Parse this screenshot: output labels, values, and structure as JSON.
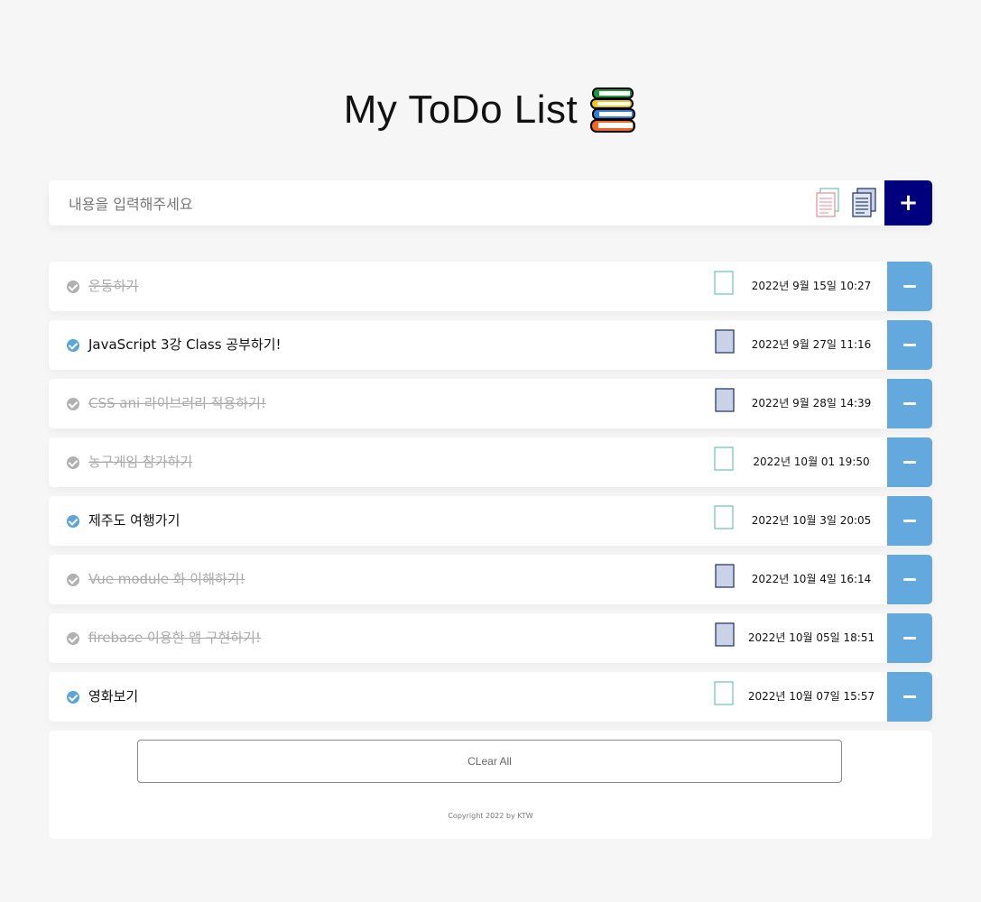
{
  "header": {
    "title": "My ToDo List",
    "icon": "books-icon"
  },
  "input": {
    "placeholder": "내용을 입력해주세요",
    "value": "",
    "add_label": "+",
    "icons": [
      "document-outline-icon",
      "document-blue-icon"
    ]
  },
  "todos": [
    {
      "text": "운동하기",
      "date": "2022년  9월 15일  10:27",
      "completed": true,
      "doc_icon": "document-outline-icon"
    },
    {
      "text": "JavaScript 3강 Class 공부하기!",
      "date": "2022년  9월 27일  11:16",
      "completed": false,
      "doc_icon": "document-blue-icon"
    },
    {
      "text": "CSS ani 라이브러리 적용하기!",
      "date": "2022년  9월 28일  14:39",
      "completed": true,
      "doc_icon": "document-blue-icon"
    },
    {
      "text": "농구게임 참가하기",
      "date": "2022년  10월 01  19:50",
      "completed": true,
      "doc_icon": "document-outline-icon"
    },
    {
      "text": "제주도 여행가기",
      "date": "2022년  10월 3일  20:05",
      "completed": false,
      "doc_icon": "document-outline-icon"
    },
    {
      "text": "Vue module 화 이해하기!",
      "date": "2022년  10월 4일  16:14",
      "completed": true,
      "doc_icon": "document-blue-icon"
    },
    {
      "text": "firebase 이용한 앱 구현하기!",
      "date": "2022년  10월 05일  18:51",
      "completed": true,
      "doc_icon": "document-blue-icon"
    },
    {
      "text": "영화보기",
      "date": "2022년  10월 07일  15:57",
      "completed": false,
      "doc_icon": "document-outline-icon"
    }
  ],
  "footer": {
    "clear_label": "CLear All",
    "copyright": "Copyright 2022 by KTW"
  },
  "colors": {
    "add_button": "#00007f",
    "delete_button": "#64a9de",
    "check_active": "#5ba4dc",
    "check_done": "#b1b1b1",
    "background": "#f6f6f6"
  }
}
